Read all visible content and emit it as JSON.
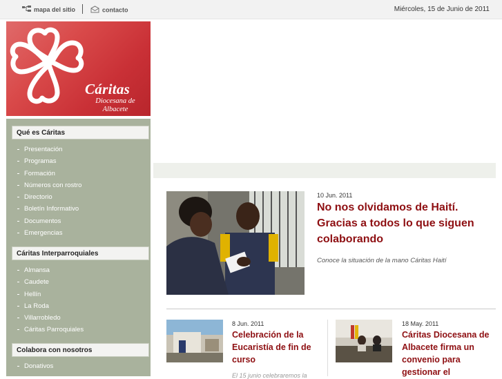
{
  "topbar": {
    "sitemap_label": "mapa del sitio",
    "contact_label": "contacto",
    "date": "Miércoles, 15 de Junio de 2011"
  },
  "logo": {
    "brand": "Cáritas",
    "subtitle_line1": "Diocesana de",
    "subtitle_line2": "Albacete",
    "color": "#d33a3f"
  },
  "sidebar": {
    "sections": [
      {
        "title": "Qué es Cáritas",
        "items": [
          "Presentación",
          "Programas",
          "Formación",
          "Números con rostro",
          "Directorio",
          "Boletín Informativo",
          "Documentos",
          "Emergencias"
        ]
      },
      {
        "title": "Cáritas Interparroquiales",
        "items": [
          "Almansa",
          "Caudete",
          "Hellín",
          "La Roda",
          "Villarrobledo",
          "Cáritas Parroquiales"
        ]
      },
      {
        "title": "Colabora con nosotros",
        "items": [
          "Donativos"
        ]
      }
    ]
  },
  "featured": {
    "date": "10 Jun. 2011",
    "title": "No nos olvidamos de Haití. Gracias a todos lo que siguen colaborando",
    "summary": "Conoce la situación de la mano Cáritas Haití"
  },
  "news": [
    {
      "date": "8 Jun. 2011",
      "title": "Celebración de la Eucaristía de fin de curso",
      "summary": "El 15 junio celebraremos la"
    },
    {
      "date": "18 May. 2011",
      "title": "Cáritas Diocesana de Albacete firma un convenio para gestionar el"
    }
  ],
  "colors": {
    "accent": "#8e0f12",
    "sidebar_bg": "#a9b29d"
  }
}
